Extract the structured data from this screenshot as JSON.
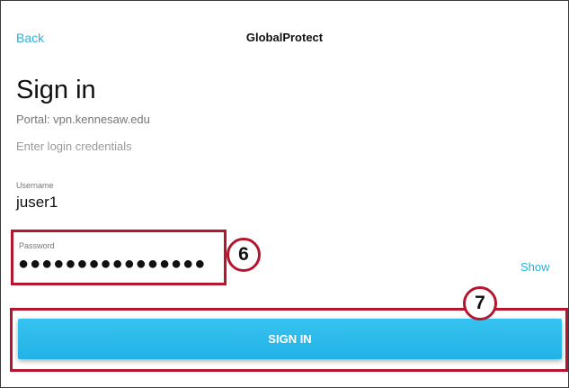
{
  "header": {
    "back_label": "Back",
    "title": "GlobalProtect"
  },
  "form": {
    "heading": "Sign in",
    "portal": "Portal: vpn.kennesaw.edu",
    "hint": "Enter login credentials",
    "username_label": "Username",
    "username_value": "juser1",
    "password_label": "Password",
    "password_value": "●●●●●●●●●●●●●●●●",
    "show_label": "Show",
    "submit_label": "SIGN IN"
  },
  "annotations": {
    "step6": "6",
    "step7": "7"
  },
  "colors": {
    "accent": "#2ab0e0",
    "highlight": "#b4162d"
  }
}
